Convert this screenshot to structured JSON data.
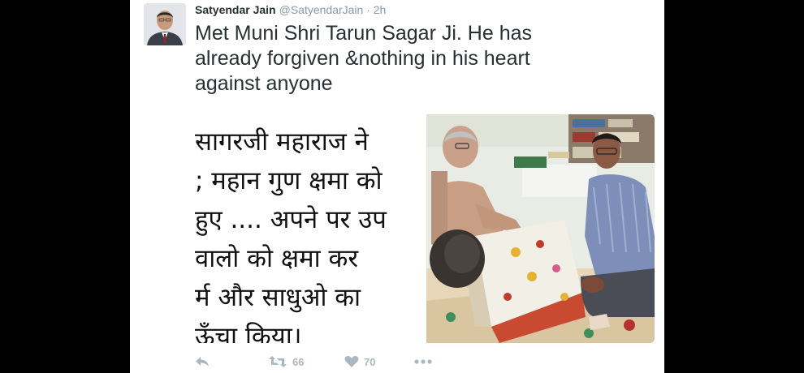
{
  "tweet": {
    "author_name": "Satyendar Jain",
    "author_handle": "@SatyendarJain",
    "time": " · 2h",
    "text_lines": [
      "Met Muni Shri Tarun Sagar Ji. He has",
      "already forgiven &nothing in his heart",
      "against anyone"
    ]
  },
  "media": {
    "hindi_lines": [
      "सागरजी  महाराज ने",
      "; महान गुण क्षमा को",
      "हुए .... अपने पर उप",
      "वालो को क्षमा कर",
      "र्म  और  साधुओ का",
      "ऊँचा किया।"
    ]
  },
  "actions": {
    "reply_icon": "reply-icon",
    "retweet_icon": "retweet-icon",
    "retweet_count": "66",
    "like_icon": "heart-icon",
    "like_count": "70",
    "more_icon": "more-icon"
  },
  "colors": {
    "text": "#292f33",
    "muted": "#8899a6",
    "action": "#aab8c2",
    "background": "#ffffff",
    "surround": "#000000"
  }
}
